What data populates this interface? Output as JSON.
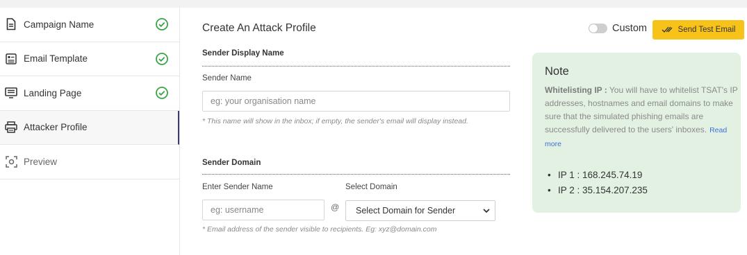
{
  "sidebar": {
    "items": [
      {
        "label": "Campaign Name",
        "icon": "document-icon",
        "completed": true,
        "active": false
      },
      {
        "label": "Email Template",
        "icon": "template-icon",
        "completed": true,
        "active": false
      },
      {
        "label": "Landing Page",
        "icon": "monitor-icon",
        "completed": true,
        "active": false
      },
      {
        "label": "Attacker Profile",
        "icon": "printer-icon",
        "completed": false,
        "active": true
      },
      {
        "label": "Preview",
        "icon": "preview-icon",
        "completed": false,
        "active": false
      }
    ]
  },
  "main": {
    "title": "Create An Attack Profile",
    "custom_label": "Custom",
    "send_test_label": "Send Test Email",
    "sender_display": {
      "heading": "Sender Display Name",
      "field_label": "Sender Name",
      "placeholder": "eg: your organisation name",
      "hint": "* This name will show in the inbox; if empty, the sender's email will display instead."
    },
    "sender_domain": {
      "heading": "Sender Domain",
      "name_label": "Enter Sender Name",
      "name_placeholder": "eg: username",
      "at": "@",
      "domain_label": "Select Domain",
      "domain_selected": "Select Domain for Sender",
      "hint": "* Email address of the sender visible to recipients. Eg: xyz@domain.com"
    }
  },
  "note": {
    "title": "Note",
    "bold_lead": "Whitelisting IP :",
    "text": " You will have to whitelist TSAT's IP addresses, hostnames and email domains to make sure that the simulated phishing emails are successfully delivered to the users' inboxes.",
    "read_more": "Read more",
    "ips": [
      "IP 1 : 168.245.74.19",
      "IP 2 : 35.154.207.235"
    ]
  },
  "colors": {
    "accent_yellow": "#f7c21a",
    "check_green": "#3aa547",
    "note_bg": "#e3f1e3",
    "link_blue": "#3a6fd8"
  }
}
